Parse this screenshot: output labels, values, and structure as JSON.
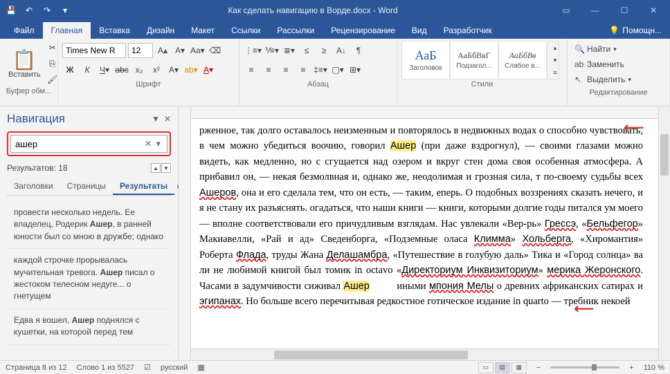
{
  "titlebar": {
    "title": "Как сделать навигацию в Ворде.docx - Word"
  },
  "tabs": {
    "file": "Файл",
    "home": "Главная",
    "insert": "Вставка",
    "design": "Дизайн",
    "layout": "Макет",
    "references": "Ссылки",
    "mailings": "Рассылки",
    "review": "Рецензирование",
    "view": "Вид",
    "developer": "Разработчик",
    "help": "Помощн..."
  },
  "ribbon": {
    "clipboard": {
      "paste": "Вставить",
      "label": "Буфер обм..."
    },
    "font": {
      "name": "Times New R",
      "size": "12",
      "label": "Шрифт"
    },
    "paragraph": {
      "label": "Абзац"
    },
    "styles": {
      "s1": "АаБ",
      "s1n": "Заголовок",
      "s2": "АаБбВвГ",
      "s2n": "Подзагол...",
      "s3": "АаБбВв",
      "s3n": "Слабое в...",
      "label": "Стили"
    },
    "editing": {
      "find": "Найти",
      "replace": "Заменить",
      "select": "Выделить",
      "label": "Редактирование"
    }
  },
  "nav": {
    "title": "Навигация",
    "search_value": "ашер",
    "results_count": "Результатов: 18",
    "tab_headings": "Заголовки",
    "tab_pages": "Страницы",
    "tab_results": "Результаты",
    "items": [
      "провести несколько недель. Ее владелец, Родерик <b>Ашер</b>, в ранней юности был со мною в дружбе; однако",
      "каждой строчке прорывалась мучительная тревога. <b>Ашер</b> писал о жестоком телесном недуге... о гнетущем",
      "Едва я вошел, <b>Ашер</b> поднялся с кушетки, на которой перед тем"
    ]
  },
  "document": {
    "text": "рженное, так долго оставалось неизменным и повторялось в недвижных водах о способно чувствовать, в чем можно убедиться воочию, говорил <span class='hl'>Ашер</span> (при даже вздрогнул), — своими глазами можно видеть, как медленно, но с сгущается над озером и вкруг стен дома своя особенная атмосфера. А прибавил он, — некая безмолвная и, однако же, неодолимая и грозная сила, т по-своему судьбы всех <span class='wavy'>Ашеров</span>, она и его сделала тем, что он есть, — таким, еперь. О подобных воззрениях сказать нечего, и я не стану их разъяснять. огадаться, что наши книги — книги, которыми долгие годы питался ум моего — вполне соответствовали его причудливым взглядам. Нас увлекали «Вер-рь» <span class='wavy'>Грессэ</span>, «<span class='wavy'>Бельфегор</span>» Макиавелли, «Рай и ад» Сведенборга, «Подземные оласа <span class='wavy'>Климма</span>» <span class='wavy'>Хольберга</span>, «Хиромантия» Роберта <span class='wavy'>Флада</span>, труды Жана <span class='wavy'>Делашамбра</span>, «Путешествие в голубую даль» Тика и «Город солнца» ва ли не любимой книгой был томик in octavo «<span class='wavy'>Директориум Инквизиториум</span>» <span class='wavy'>мерика Жеронского</span>. Часами в задумчивости сиживал <span class='hl'>Ашер</span> &nbsp;&nbsp;&nbsp;&nbsp;&nbsp;&nbsp;&nbsp; иными <span class='wavy'>мпония Мелы</span> о древних африканских сатирах и <span class='wavy'>эгипанах</span>. Но больше всего перечитывая редкостное готическое издание in quarto — требник некоей"
  },
  "statusbar": {
    "page": "Страница 8 из 12",
    "words": "Слово 1 из 5527",
    "lang": "русский",
    "zoom": "110 %"
  }
}
